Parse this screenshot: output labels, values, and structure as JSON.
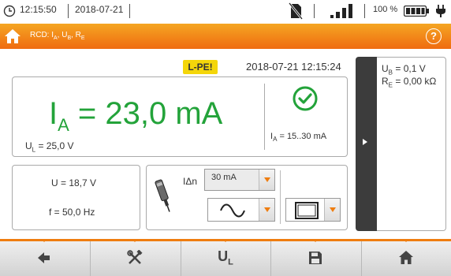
{
  "status": {
    "time": "12:15:50",
    "date": "2018-07-21",
    "battery_pct": "100 %",
    "battery_level": 1.0,
    "signal_bars": 4,
    "icons": [
      "clock-icon",
      "sd-card-crossed-icon",
      "signal-icon",
      "battery-icon",
      "plug-icon"
    ]
  },
  "titlebar": {
    "title_main": "RCD: I",
    "title_sub1": "A",
    "title_sep1": ", U",
    "title_sub2": "B",
    "title_sep2": ", R",
    "title_sub3": "E",
    "help_label": "?",
    "accent": "#ef7d10"
  },
  "measurement": {
    "badge": "L-PE!",
    "timestamp": "2018-07-21 12:15:24",
    "main_symbol": "I",
    "main_symbol_sub": "A",
    "main_value": " = 23,0 mA",
    "ul_symbol": "U",
    "ul_sub": "L",
    "ul_value": " = 25,0 V",
    "ia_symbol": "I",
    "ia_sub": "A",
    "ia_range": " = 15..30 mA",
    "result_color": "#23a33a",
    "result_status": "ok-icon"
  },
  "voltage": {
    "u": "U = 18,7 V",
    "f": "f = 50,0 Hz"
  },
  "settings": {
    "idn_label": "IΔn",
    "current_selected": "30 mA",
    "waveform_selected": "sine-wave-icon",
    "rcd_type_selected": "rcd-type-general-icon"
  },
  "side_panel": {
    "ub_symbol": "U",
    "ub_sub": "B",
    "ub_value": " = 0,1 V",
    "re_symbol": "R",
    "re_sub": "E",
    "re_value": " = 0,00 kΩ"
  },
  "toolbar": {
    "buttons": [
      {
        "name": "back-button",
        "icon": "arrow-left-icon"
      },
      {
        "name": "settings-button",
        "icon": "tools-icon"
      },
      {
        "name": "ul-button",
        "label": "U",
        "sub": "L"
      },
      {
        "name": "save-button",
        "icon": "floppy-icon"
      },
      {
        "name": "home-button",
        "icon": "home-icon"
      }
    ]
  }
}
